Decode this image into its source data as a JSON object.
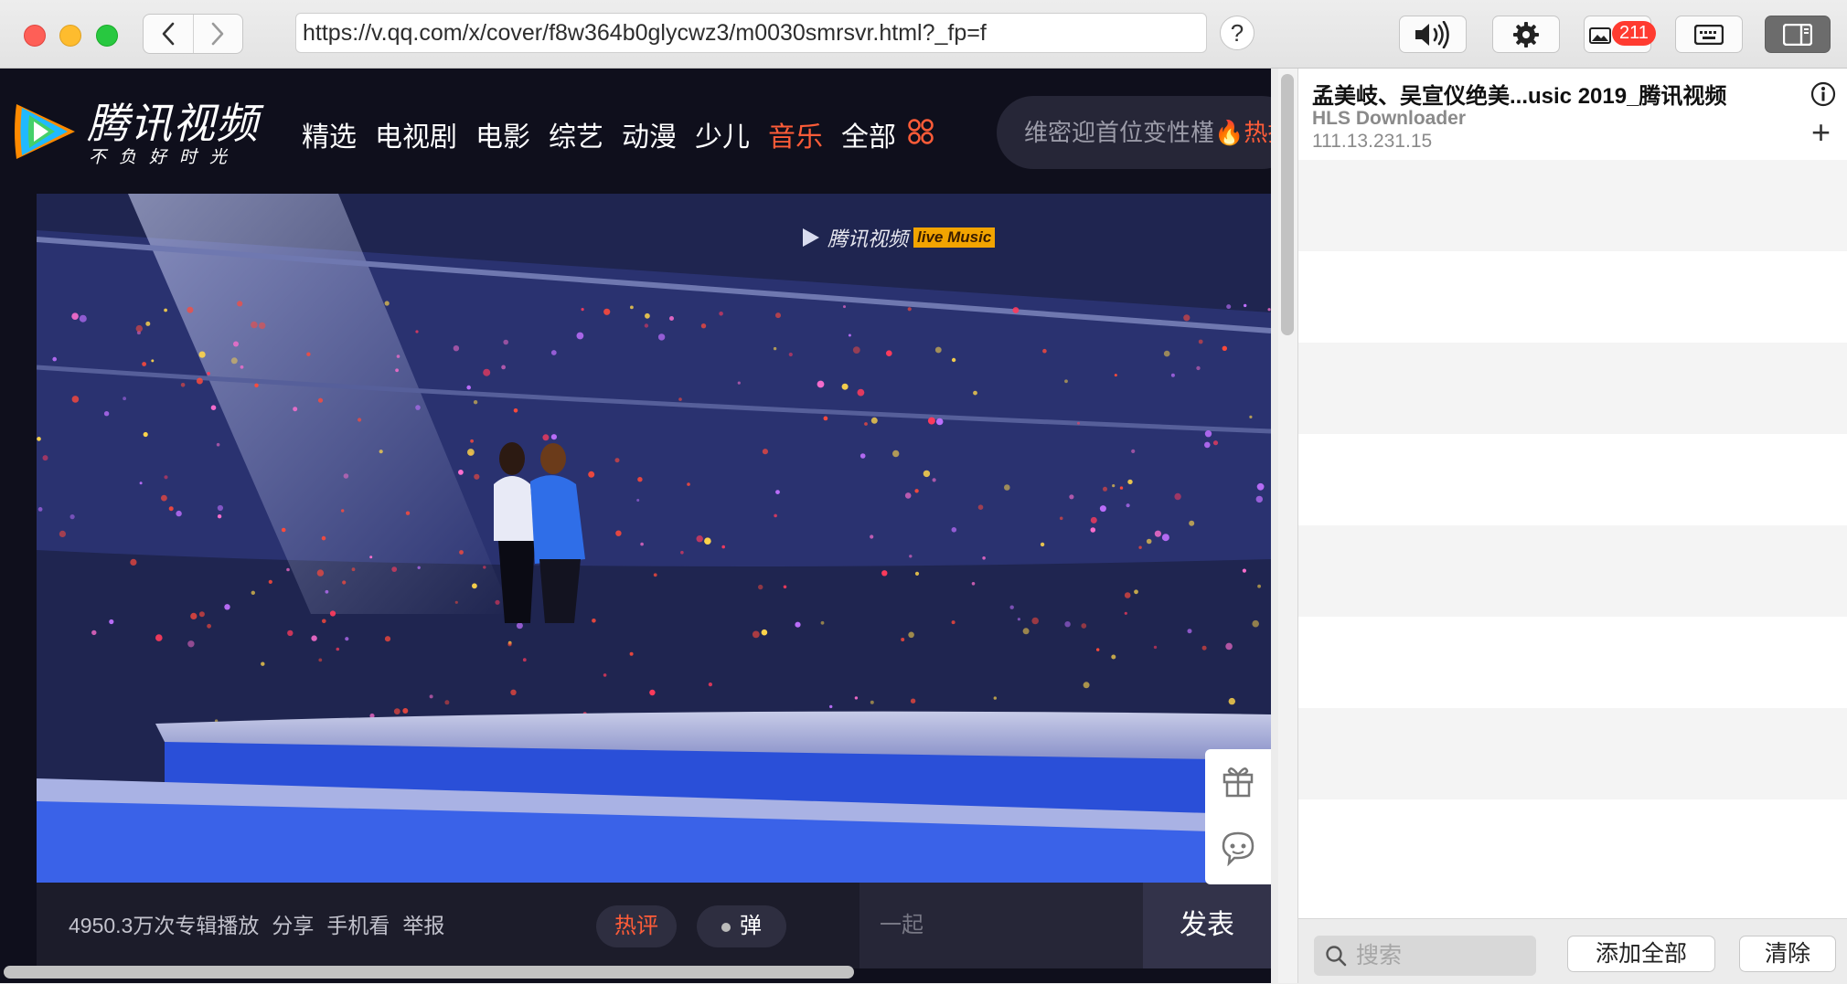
{
  "toolbar": {
    "url": "https://v.qq.com/x/cover/f8w364b0glycwz3/m0030smrsvr.html?_fp=f",
    "help_label": "?",
    "badge_count": "211"
  },
  "site": {
    "logo_title": "腾讯视频",
    "logo_slogan": "不负好时光",
    "nav": [
      "精选",
      "电视剧",
      "电影",
      "综艺",
      "动漫",
      "少儿",
      "音乐",
      "全部"
    ],
    "active_nav": "音乐",
    "search_placeholder": "维密迎首位变性槿",
    "hot_search": "🔥热搜",
    "watermark_brand": "腾讯视频",
    "watermark_tag": "live Music",
    "play_count": "4950.3万次专辑播放",
    "actions": [
      "分享",
      "手机看",
      "举报"
    ],
    "hot_comments": "热评",
    "danmaku": "弹",
    "comment_placeholder": "一起",
    "post_label": "发表"
  },
  "panel": {
    "item_title": "孟美岐、吴宣仪绝美...usic 2019_腾讯视频",
    "item_subtitle": "HLS Downloader",
    "item_ip": "111.13.231.15",
    "search_placeholder": "搜索",
    "add_all_label": "添加全部",
    "clear_label": "清除"
  },
  "colors": {
    "accent": "#ff5c38",
    "badge": "#ff3b30",
    "site_bg": "#0f0f1c"
  }
}
